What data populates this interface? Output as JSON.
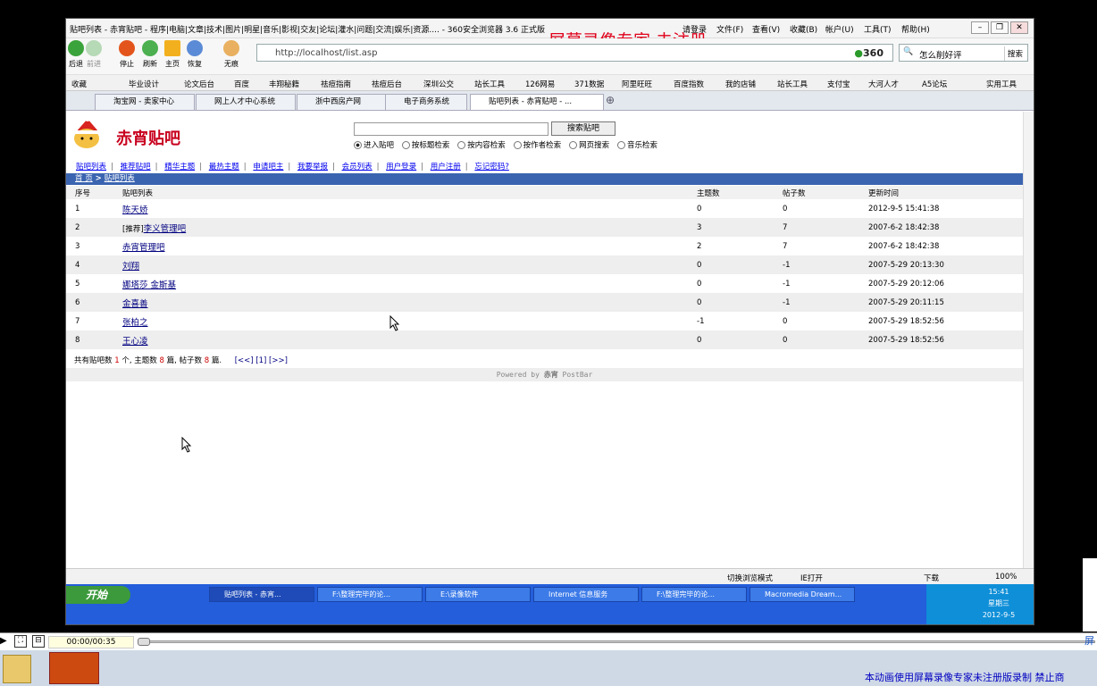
{
  "browser": {
    "title": "贴吧列表 - 赤宵贴吧 - 程序|电脑|文章|技术|图片|明星|音乐|影视|交友|论坛|灌水|问题|交流|娱乐|资源.... - 360安全浏览器 3.6 正式版",
    "menu": [
      "请登录",
      "文件(F)",
      "查看(V)",
      "收藏(B)",
      "帐户(U)",
      "工具(T)",
      "帮助(H)"
    ],
    "watermark": "屏幕录像专家 未注册",
    "nav_buttons": [
      "后退",
      "前进",
      "停止",
      "刷新",
      "主页",
      "恢复",
      "无痕"
    ],
    "address": "http://localhost/list.asp",
    "brand_360": "360",
    "search_text": "怎么削好评",
    "search_button": "搜索",
    "bookmarks": [
      "收藏",
      "毕业设计",
      "论文后台",
      "百度",
      "丰翔秘籍",
      "祛痘指南",
      "祛痘后台",
      "深圳公交",
      "站长工具",
      "126网易",
      "371数据",
      "阿里旺旺",
      "百度指数",
      "我的店铺",
      "站长工具",
      "支付宝",
      "大河人才",
      "A5论坛",
      "实用工具"
    ],
    "tabs": [
      "淘宝网 - 卖家中心",
      "网上人才中心系统",
      "浙中西房产网",
      "电子商务系统",
      "贴吧列表 - 赤宵贴吧 - ..."
    ],
    "status_items": [
      "切换浏览模式",
      "IE打开",
      "下载",
      "100%"
    ]
  },
  "page": {
    "logo_text": "赤宵贴吧",
    "search_button": "搜索贴吧",
    "radios": [
      "进入贴吧",
      "按标题检索",
      "按内容检索",
      "按作者检索",
      "网页搜索",
      "音乐检索"
    ],
    "links": [
      "贴吧列表",
      "推荐贴吧",
      "精华主题",
      "最热主题",
      "申请吧主",
      "我要举报",
      "会员列表",
      "用户登录",
      "用户注册",
      "忘记密码?"
    ],
    "crumb_home": "首 页",
    "crumb_sep": " > ",
    "crumb_current": "贴吧列表",
    "headers": [
      "序号",
      "贴吧列表",
      "主题数",
      "帖子数",
      "更新时间"
    ],
    "rows": [
      {
        "no": "1",
        "prefix": "",
        "name": "陈天娇",
        "topics": "0",
        "posts": "0",
        "updated": "2012-9-5 15:41:38"
      },
      {
        "no": "2",
        "prefix": "[推荐]",
        "name": "李义管理吧",
        "topics": "3",
        "posts": "7",
        "updated": "2007-6-2 18:42:38"
      },
      {
        "no": "3",
        "prefix": "",
        "name": "赤宵管理吧",
        "topics": "2",
        "posts": "7",
        "updated": "2007-6-2 18:42:38"
      },
      {
        "no": "4",
        "prefix": "",
        "name": "刘翔",
        "topics": "0",
        "posts": "-1",
        "updated": "2007-5-29 20:13:30"
      },
      {
        "no": "5",
        "prefix": "",
        "name": "娜塔莎 金斯基",
        "topics": "0",
        "posts": "-1",
        "updated": "2007-5-29 20:12:06"
      },
      {
        "no": "6",
        "prefix": "",
        "name": "金喜善",
        "topics": "0",
        "posts": "-1",
        "updated": "2007-5-29 20:11:15"
      },
      {
        "no": "7",
        "prefix": "",
        "name": "张柏之",
        "topics": "-1",
        "posts": "0",
        "updated": "2007-5-29 18:52:56"
      },
      {
        "no": "8",
        "prefix": "",
        "name": "王心凌",
        "topics": "0",
        "posts": "0",
        "updated": "2007-5-29 18:52:56"
      }
    ],
    "summary_a": "共有贴吧数",
    "summary_bars": "1",
    "summary_b": "个, 主题数",
    "summary_topics": "8",
    "summary_c": "篇, 帖子数",
    "summary_posts": "8",
    "summary_d": "篇.",
    "pager": "[<<] [1] [>>]",
    "footer_powered": "Powered by",
    "footer_name": "赤宵",
    "footer_brand": "PostBar"
  },
  "taskbar": {
    "start": "开始",
    "items": [
      "贴吧列表 - 赤宵...",
      "F:\\整理完毕的论...",
      "E:\\录像软件",
      "Internet 信息服务",
      "F:\\整理完毕的论...",
      "Macromedia Dream..."
    ],
    "clock": "15:41",
    "weekday": "星期三",
    "date": "2012-9-5"
  },
  "player": {
    "time": "00:00/00:35",
    "notice": "本动画使用屏幕录像专家未注册版录制 禁止商",
    "side_text": "屏"
  }
}
